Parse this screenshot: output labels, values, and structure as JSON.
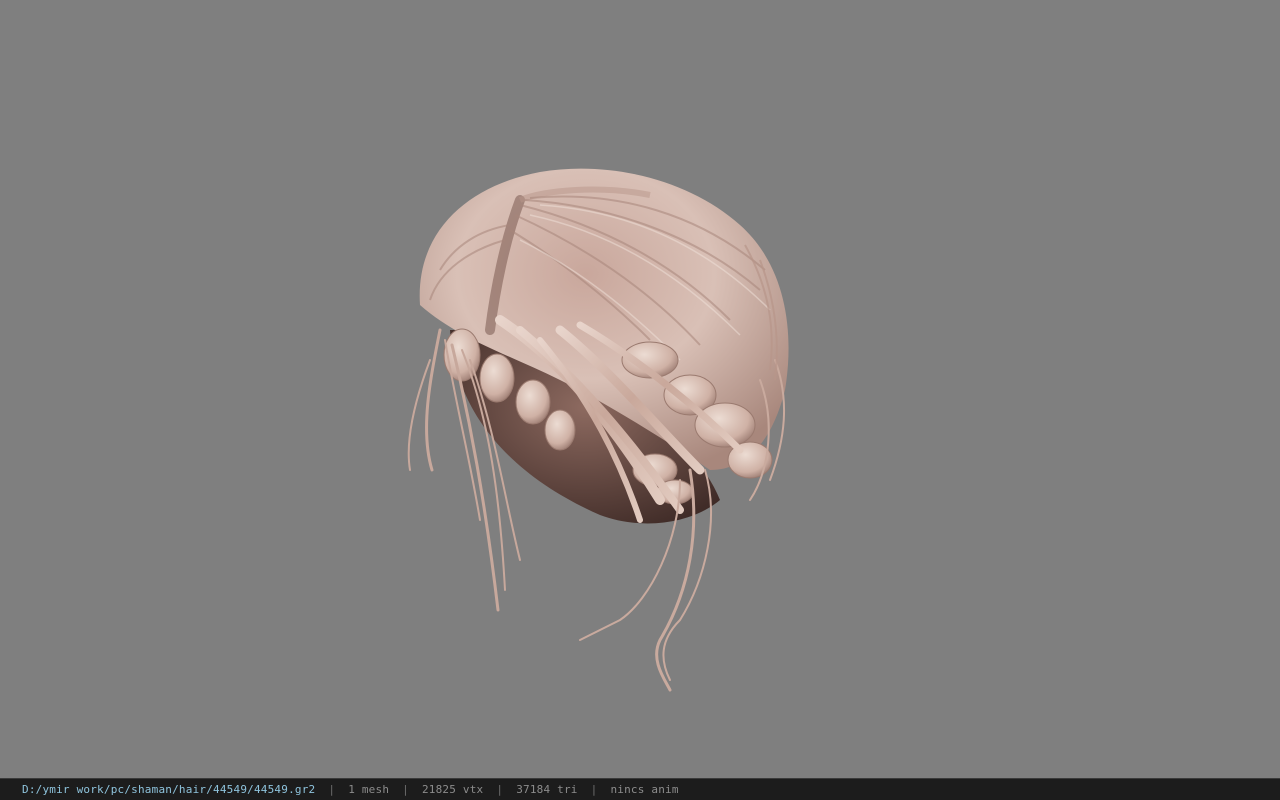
{
  "viewer": {
    "background_color": "#7f7f7f",
    "model_icon": "hair-model-icon"
  },
  "status": {
    "file_path": "D:/ymir work/pc/shaman/hair/44549/44549.gr2",
    "separator": "|",
    "mesh": "1 mesh",
    "vertices": "21825 vtx",
    "triangles": "37184 tri",
    "animation": "nincs anim",
    "path_color": "#8ec3dc",
    "text_color": "#8c8c8c"
  }
}
